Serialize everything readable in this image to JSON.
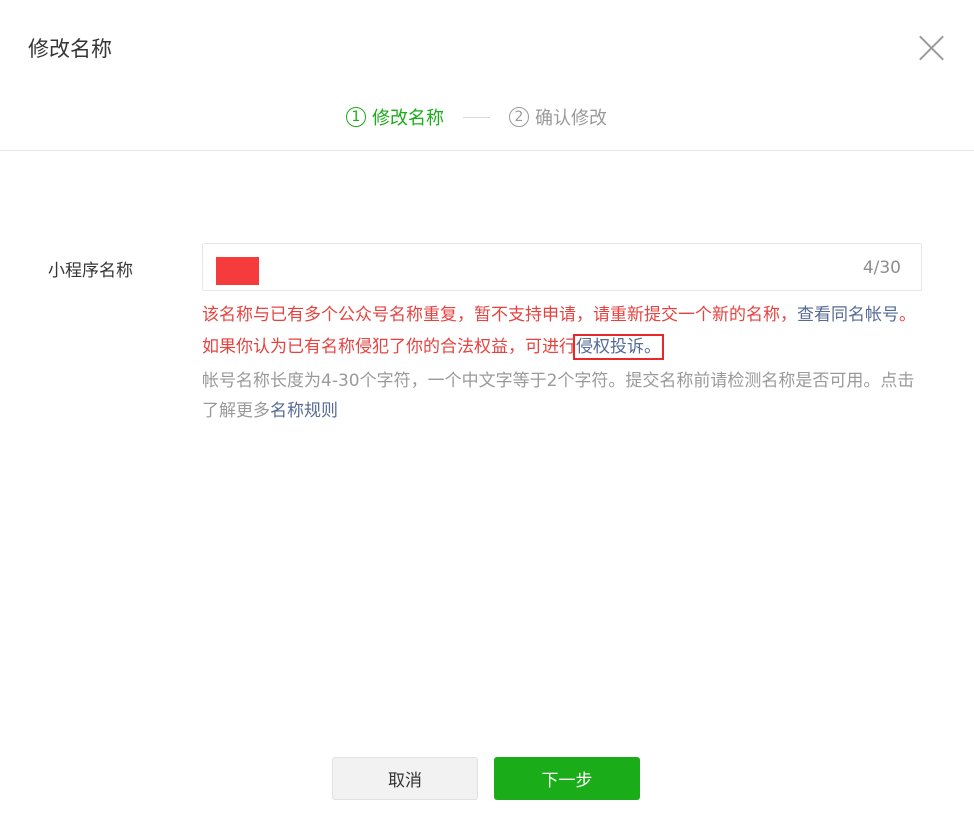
{
  "dialog": {
    "title": "修改名称"
  },
  "steps": [
    {
      "number": "1",
      "label": "修改名称",
      "active": true
    },
    {
      "number": "2",
      "label": "确认修改",
      "active": false
    }
  ],
  "form": {
    "label": "小程序名称",
    "counter": "4/30"
  },
  "error": {
    "text_part1": "该名称与已有多个公众号名称重复，暂不支持申请，请重新提交一个新的名称，",
    "link_same_name": "查看同名帐号",
    "text_part2": "。如果你认为已有名称侵犯了你的合法权益，可进行",
    "link_complaint": "侵权投诉。"
  },
  "hint": {
    "text": "帐号名称长度为4-30个字符，一个中文字等于2个字符。提交名称前请检测名称是否可用。点击了解更多",
    "link_rules": "名称规则"
  },
  "buttons": {
    "cancel": "取消",
    "next": "下一步"
  },
  "colors": {
    "accent": "#1aad19",
    "error": "#e64340",
    "link": "#576b95",
    "redaction": "#f53b3b"
  }
}
